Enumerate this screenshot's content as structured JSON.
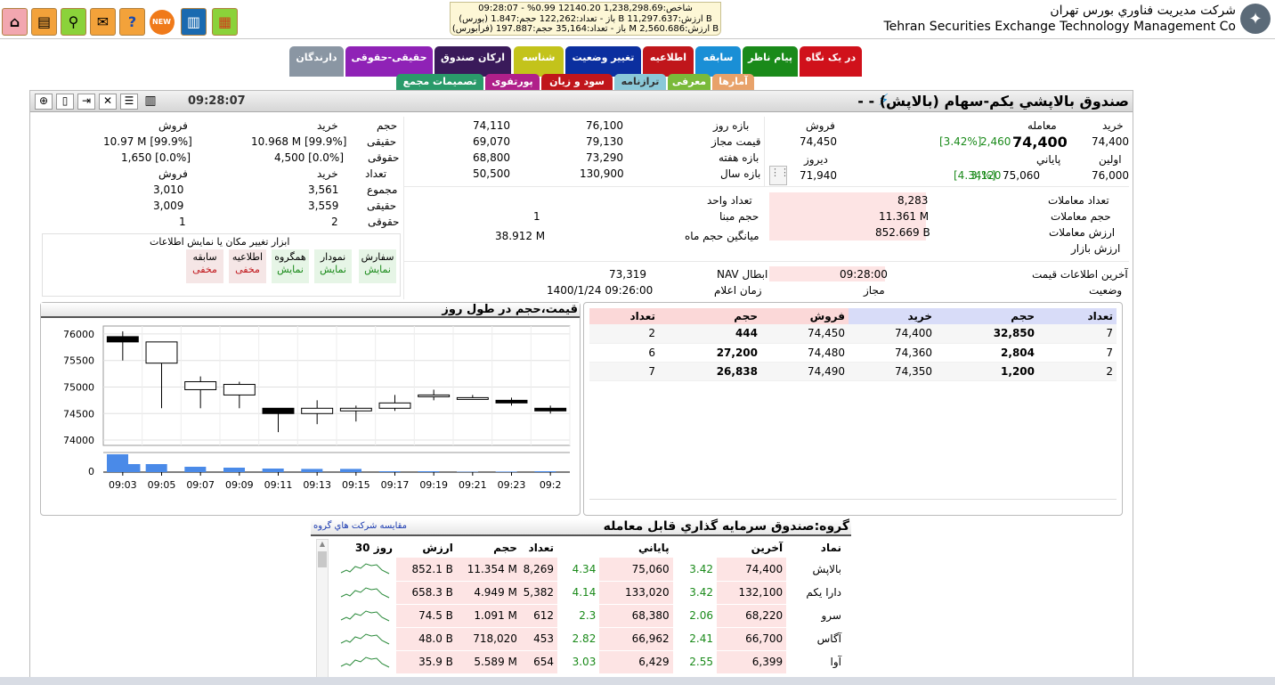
{
  "ticker": {
    "line1": "شاخص:1,238,298.69 12140.20 0.99% - 09:28:07",
    "line2": "(بورس) باز - تعداد:122,262 حجم:1.847 B ارزش:11,297.637 B",
    "line3": "(فرابورس) باز - تعداد:35,164 حجم:197.887 M ارزش:2,560.686 B"
  },
  "company": {
    "fa": "شرکت مديريت فناوري بورس تهران",
    "en": "Tehran Securities Exchange Technology Management Co"
  },
  "toolbar": {
    "new_badge": "NEW"
  },
  "tabs": [
    {
      "label": "در يک نگاه",
      "color": "#d0111b"
    },
    {
      "label": "پيام ناظر",
      "color": "#1a8a1a"
    },
    {
      "label": "سابقه",
      "color": "#1a8fd6"
    },
    {
      "label": "اطلاعيه",
      "color": "#c0161b"
    },
    {
      "label": "تغيير وضعيت",
      "color": "#0b2f9f"
    },
    {
      "label": "شناسه",
      "color": "#c3c31b"
    },
    {
      "label": "ارکان صندوق",
      "color": "#3a1a5a"
    },
    {
      "label": "حقيقی-حقوقی",
      "color": "#8f22b6"
    },
    {
      "label": "دارندگان",
      "color": "#8a96a3"
    }
  ],
  "tabs2": [
    {
      "label": "آمارها",
      "color": "#e8a26a"
    },
    {
      "label": "معرفی",
      "color": "#7aba3a"
    },
    {
      "label": "ترازنامه",
      "color": "#8ac8d8"
    },
    {
      "label": "سود و زيان",
      "color": "#c0161b"
    },
    {
      "label": "پورتفوی",
      "color": "#b0208a"
    },
    {
      "label": "تصميمات مجمع",
      "color": "#2a9a6a"
    }
  ],
  "header": {
    "time": "09:28:07",
    "title": "صندوق بالاپشي يکم-سهام (بالاپش) - -"
  },
  "trade": {
    "buy_lbl": "خريد",
    "deal_lbl": "معامله",
    "sell_lbl": "فروش",
    "buy_val": "74,400",
    "deal_val": "74,400",
    "deal_chg": "2,460",
    "deal_pct": "[3.42%]",
    "sell_val": "74,450",
    "first_lbl": "اولين",
    "first_val": "76,000",
    "close_lbl": "پاياني",
    "close_val": "75,060",
    "close_chg": "3,120",
    "close_pct": "[4.34%]",
    "yday_lbl": "ديروز",
    "yday_val": "71,940",
    "day_range_lbl": "بازه روز",
    "day_hi": "76,100",
    "day_lo": "74,110",
    "allowed_lbl": "قيمت مجاز",
    "allowed_hi": "79,130",
    "allowed_lo": "69,070",
    "week_lbl": "بازه هفته",
    "week_hi": "73,290",
    "week_lo": "68,800",
    "year_lbl": "بازه سال",
    "year_hi": "130,900",
    "year_lo": "50,500"
  },
  "stats": {
    "count_lbl": "تعداد معاملات",
    "count_val": "8,283",
    "vol_lbl": "حجم معاملات",
    "vol_val": "11.361 M",
    "value_lbl": "ارزش معاملات",
    "value_val": "852.669 B",
    "mcap_lbl": "ارزش بازار",
    "unit_lbl": "تعداد واحد",
    "base_lbl": "حجم مبنا",
    "base_val": "1",
    "avgvol_lbl": "ميانگين حجم ماه",
    "avgvol_val": "38.912 M",
    "lastinfo_lbl": "آخرين اطلاعات قيمت",
    "lastinfo_val": "09:28:00",
    "status_lbl": "وضعيت",
    "status_val": "مجاز",
    "nav_lbl": "NAV ابطال",
    "nav_val": "73,319",
    "announce_lbl": "زمان اعلام",
    "announce_val": "1400/1/24 09:26:00"
  },
  "legal": {
    "h_vol": "حجم",
    "h_buy": "خريد",
    "h_sell": "فروش",
    "real_lbl": "حقيقی",
    "real_buy": "10.968 M [99.9%]",
    "real_sell": "10.97 M [99.9%]",
    "legal_lbl": "حقوقی",
    "legal_buy": "4,500 [0.0%]",
    "legal_sell": "1,650 [0.0%]",
    "h_count": "تعداد",
    "h_buy2": "خريد",
    "h_sell2": "فروش",
    "sum_lbl": "مجموع",
    "sum_buy": "3,561",
    "sum_sell": "3,010",
    "real2_lbl": "حقيقی",
    "real2_buy": "3,559",
    "real2_sell": "3,009",
    "legal2_lbl": "حقوقی",
    "legal2_buy": "2",
    "legal2_sell": "1"
  },
  "toggles": {
    "title": "ابزار تغيير مکان يا نمايش اطلاعات",
    "items": [
      {
        "name": "سفارش",
        "state": "نمايش",
        "on": true
      },
      {
        "name": "نمودار",
        "state": "نمايش",
        "on": true
      },
      {
        "name": "همگروه",
        "state": "نمايش",
        "on": true
      },
      {
        "name": "اطلاعيه",
        "state": "مخفی",
        "on": false
      },
      {
        "name": "سابقه",
        "state": "مخفی",
        "on": false
      }
    ]
  },
  "orderbook": {
    "headers": [
      "تعداد",
      "حجم",
      "خريد",
      "فروش",
      "حجم",
      "تعداد"
    ],
    "rows": [
      [
        "7",
        "32,850",
        "74,400",
        "74,450",
        "444",
        "2"
      ],
      [
        "7",
        "2,804",
        "74,360",
        "74,480",
        "27,200",
        "6"
      ],
      [
        "2",
        "1,200",
        "74,350",
        "74,490",
        "26,838",
        "7"
      ]
    ]
  },
  "chart_title": "قيمت،حجم در طول روز",
  "chart_data": {
    "type": "candlestick",
    "ylim": [
      73900,
      76150
    ],
    "yticks": [
      "76000",
      "75500",
      "75000",
      "74500",
      "74000"
    ],
    "vol_tick": "0",
    "xticks": [
      "09:03",
      "09:05",
      "09:07",
      "09:09",
      "09:11",
      "09:13",
      "09:15",
      "09:17",
      "09:19",
      "09:21",
      "09:23",
      "09:2"
    ],
    "candles": [
      {
        "o": 75950,
        "c": 75850,
        "h": 76050,
        "l": 75500
      },
      {
        "o": 75450,
        "c": 75850,
        "h": 75850,
        "l": 74600
      },
      {
        "o": 74950,
        "c": 75100,
        "h": 75200,
        "l": 74600
      },
      {
        "o": 74850,
        "c": 75050,
        "h": 75100,
        "l": 74600
      },
      {
        "o": 74600,
        "c": 74500,
        "h": 74600,
        "l": 74150
      },
      {
        "o": 74500,
        "c": 74600,
        "h": 74750,
        "l": 74300
      },
      {
        "o": 74550,
        "c": 74600,
        "h": 74650,
        "l": 74350
      },
      {
        "o": 74600,
        "c": 74700,
        "h": 74850,
        "l": 74550
      },
      {
        "o": 74850,
        "c": 74850,
        "h": 74950,
        "l": 74750
      },
      {
        "o": 74800,
        "c": 74800,
        "h": 74850,
        "l": 74800
      },
      {
        "o": 74750,
        "c": 74700,
        "h": 74800,
        "l": 74650
      },
      {
        "o": 74600,
        "c": 74550,
        "h": 74650,
        "l": 74500
      }
    ],
    "volumes": [
      1.0,
      0.45,
      0.3,
      0.25,
      0.2,
      0.18,
      0.18,
      0.05,
      0.05,
      0.02,
      0.03,
      0.05
    ]
  },
  "group": {
    "title": "گروه:صندوق سرمايه گذاري قابل معامله",
    "compare_link": "مقايسه شرکت هاي گروه",
    "headers": [
      "نماد",
      "آخرين",
      "",
      "پاياني",
      "",
      "تعداد",
      "حجم",
      "ارزش",
      "30 روز"
    ],
    "rows": [
      [
        "بالاپش",
        "74,400",
        "3.42",
        "75,060",
        "4.34",
        "8,269",
        "11.354 M",
        "852.1 B"
      ],
      [
        "دارا يکم",
        "132,100",
        "3.42",
        "133,020",
        "4.14",
        "5,382",
        "4.949 M",
        "658.3 B"
      ],
      [
        "سرو",
        "68,220",
        "2.06",
        "68,380",
        "2.3",
        "612",
        "1.091 M",
        "74.5 B"
      ],
      [
        "آگاس",
        "66,700",
        "2.41",
        "66,962",
        "2.82",
        "453",
        "718,020",
        "48.0 B"
      ],
      [
        "آوا",
        "6,399",
        "2.55",
        "6,429",
        "3.03",
        "654",
        "5.589 M",
        "35.9 B"
      ]
    ]
  }
}
